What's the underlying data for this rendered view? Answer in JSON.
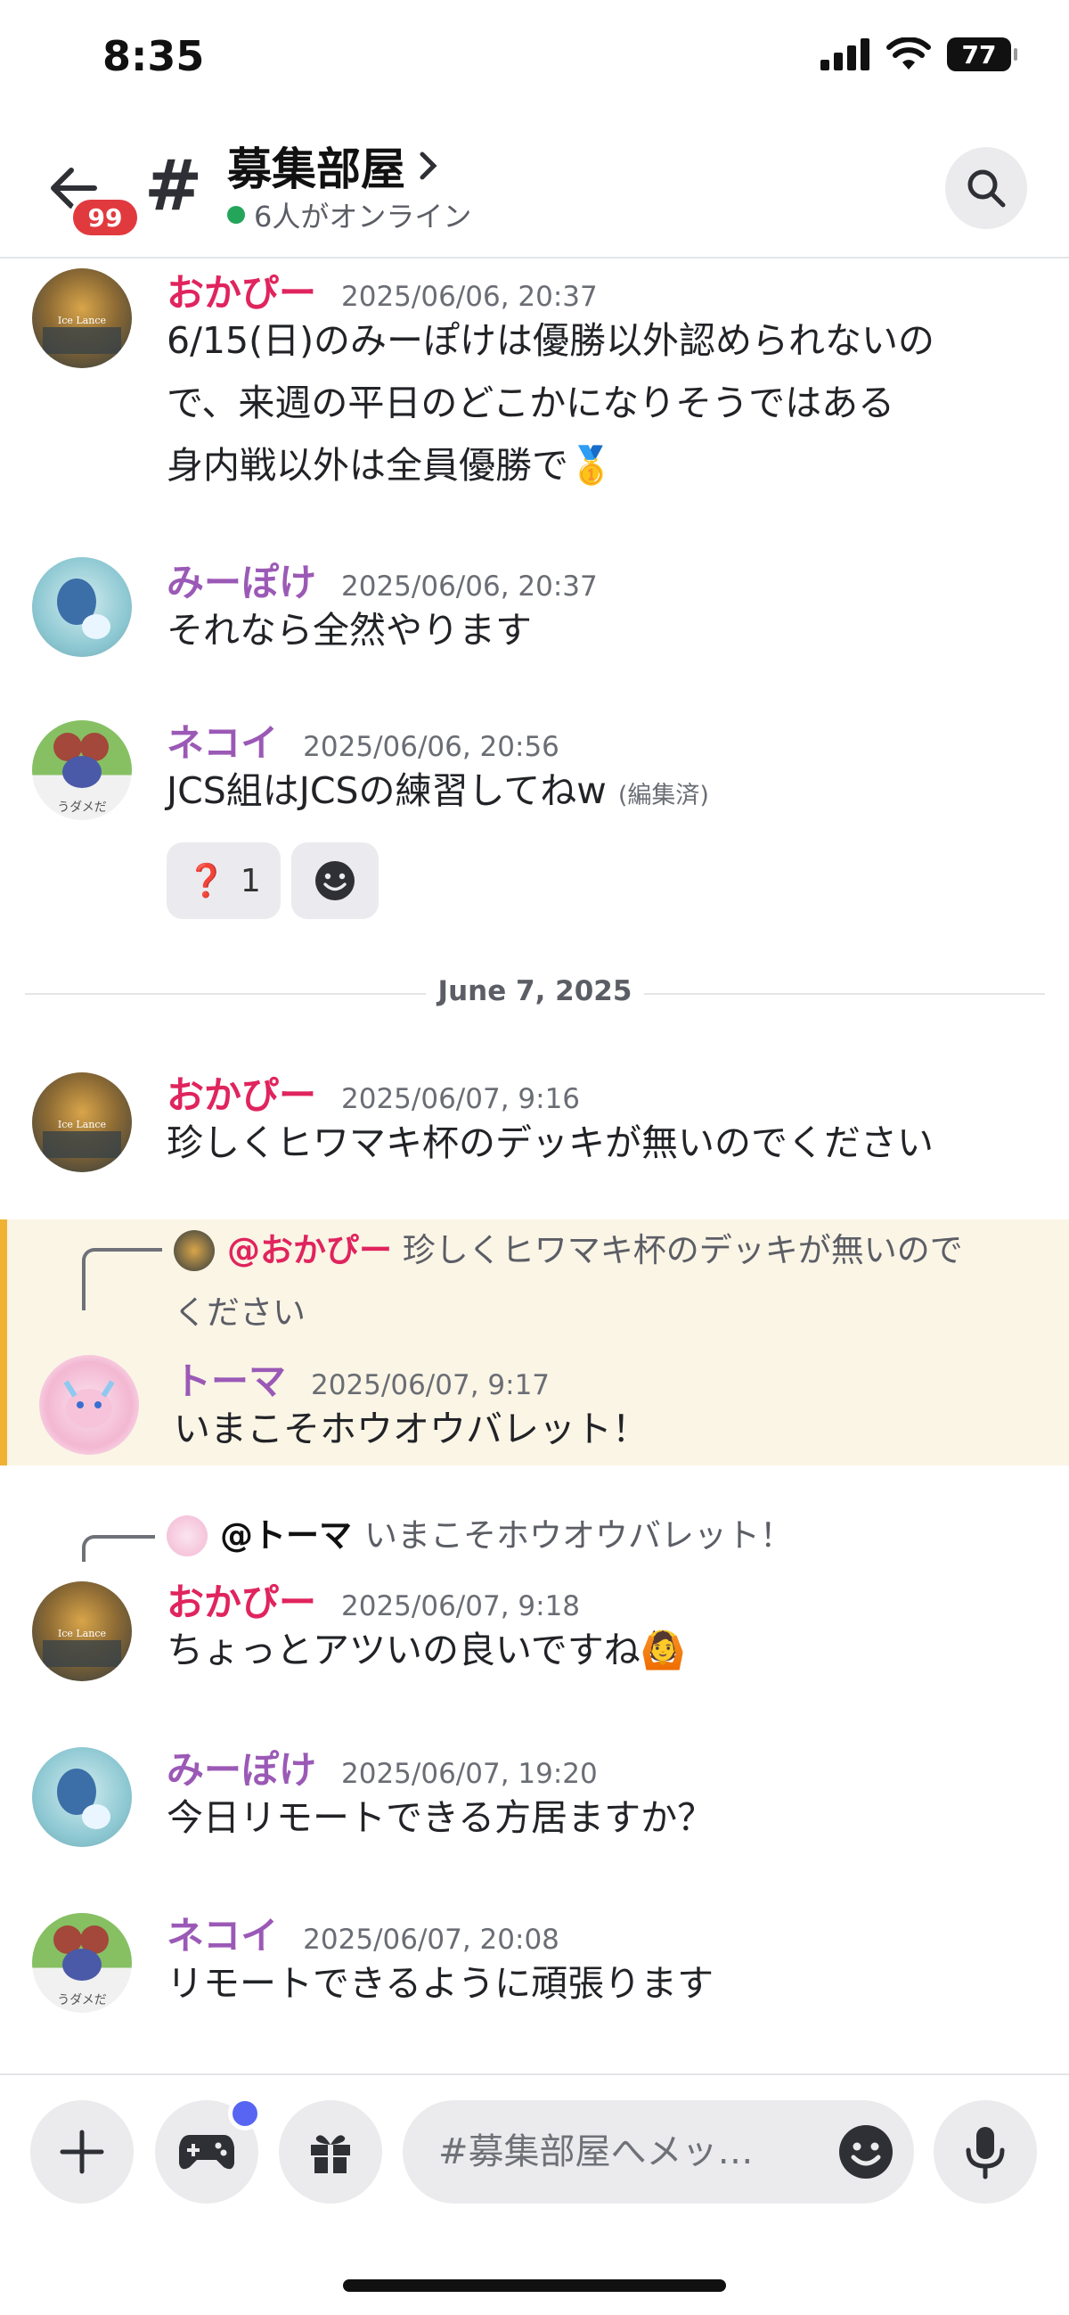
{
  "status_bar": {
    "time": "8:35",
    "battery": "77"
  },
  "header": {
    "back_badge": "99",
    "channel_name": "募集部屋",
    "online_text": "6人がオンライン"
  },
  "messages": [
    {
      "user": "おかぴー",
      "timestamp": "2025/06/06, 20:37",
      "lines": [
        "6/15(日)のみーぽけは優勝以外認められないの",
        "で、来週の平日のどこかになりそうではある",
        "身内戦以外は全員優勝で🥇"
      ]
    },
    {
      "user": "みーぽけ",
      "timestamp": "2025/06/06, 20:37",
      "text": "それなら全然やります"
    },
    {
      "user": "ネコイ",
      "timestamp": "2025/06/06, 20:56",
      "text": "JCS組はJCSの練習してねw",
      "edited": "(編集済)",
      "reactions": [
        {
          "emoji": "❓",
          "count": "1"
        }
      ]
    },
    {
      "user": "おかぴー",
      "timestamp": "2025/06/07, 9:16",
      "text": "珍しくヒワマキ杯のデッキが無いのでください"
    },
    {
      "user": "トーマ",
      "timestamp": "2025/06/07, 9:17",
      "text": "いまこそホウオウバレット！",
      "reply": {
        "user": "@おかぴー",
        "line1": "珍しくヒワマキ杯のデッキが無いので",
        "line2": "ください"
      }
    },
    {
      "user": "おかぴー",
      "timestamp": "2025/06/07, 9:18",
      "text": "ちょっとアツいの良いですね🙆",
      "reply": {
        "user": "@トーマ",
        "line1": "いまこそホウオウバレット！"
      }
    },
    {
      "user": "みーぽけ",
      "timestamp": "2025/06/07, 19:20",
      "text": "今日リモートできる方居ますか？"
    },
    {
      "user": "ネコイ",
      "timestamp": "2025/06/07, 20:08",
      "text": "リモートできるように頑張ります"
    }
  ],
  "date_divider": "June 7, 2025",
  "avatar_captions": {
    "nekoi": "うダメだ",
    "card": "Ice Lance"
  },
  "composer": {
    "placeholder": "#募集部屋へメッ…"
  },
  "colors": {
    "accent": "#5865f2",
    "pink_name": "#e0245e",
    "purple_name": "#9b59b6",
    "highlight": "#fbf5e6",
    "highlight_bar": "#f0b232",
    "online": "#23a55a",
    "badge": "#e03a3f"
  }
}
